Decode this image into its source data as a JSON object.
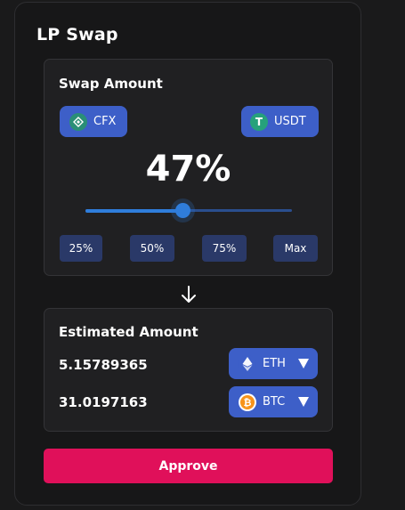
{
  "panel": {
    "title": "LP Swap"
  },
  "swap": {
    "title": "Swap Amount",
    "token_a": {
      "symbol": "CFX",
      "icon": "cfx-icon"
    },
    "token_b": {
      "symbol": "USDT",
      "icon": "usdt-icon",
      "glyph": "T"
    },
    "percent_display": "47%",
    "slider_value_percent": 47,
    "presets": [
      "25%",
      "50%",
      "75%",
      "Max"
    ]
  },
  "estimate": {
    "title": "Estimated Amount",
    "rows": [
      {
        "amount": "5.15789365",
        "symbol": "ETH",
        "icon": "eth-icon"
      },
      {
        "amount": "31.0197163",
        "symbol": "BTC",
        "icon": "btc-icon"
      }
    ]
  },
  "approve_label": "Approve",
  "colors": {
    "accent_blue": "#3d5fc8",
    "slider_blue": "#2f7ddb",
    "approve_pink": "#e0105a",
    "preset_bg": "#2a3968"
  }
}
